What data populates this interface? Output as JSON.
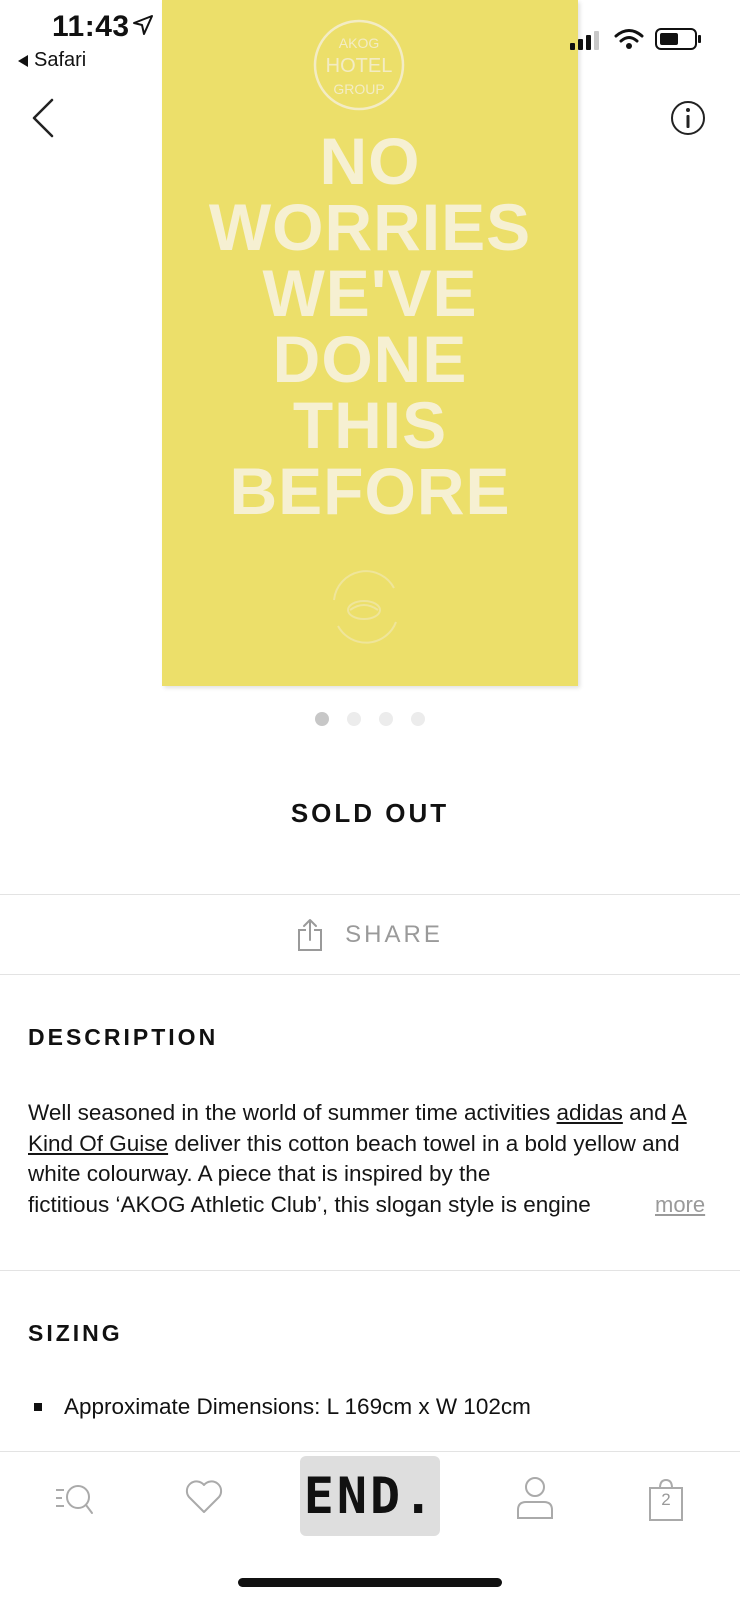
{
  "status_bar": {
    "time": "11:43",
    "back_app": "Safari"
  },
  "product_image": {
    "slogan_lines": [
      "NO",
      "WORRIES",
      "WE'VE",
      "DONE",
      "THIS",
      "BEFORE"
    ],
    "background_color": "#ecdf6a",
    "text_color": "#f6f0d2",
    "carousel": {
      "count": 4,
      "active_index": 0
    }
  },
  "status": {
    "sold_out": "SOLD OUT"
  },
  "share": {
    "label": "SHARE"
  },
  "description": {
    "heading": "DESCRIPTION",
    "text_1": "Well seasoned in the world of summer time activities ",
    "link_1": "adidas",
    "text_2": " and ",
    "link_2": "A Kind Of Guise",
    "text_3": " deliver this cotton beach towel in a bold yellow and white colourway. A piece that is inspired by the ",
    "text_4": "fictitious ‘AKOG Athletic Club’, this slogan style is engine",
    "more_label": "more"
  },
  "sizing": {
    "heading": "SIZING",
    "items": [
      "Approximate Dimensions: L 169cm x W 102cm"
    ]
  },
  "tab_bar": {
    "brand_label": "END.",
    "bag_count": "2"
  }
}
